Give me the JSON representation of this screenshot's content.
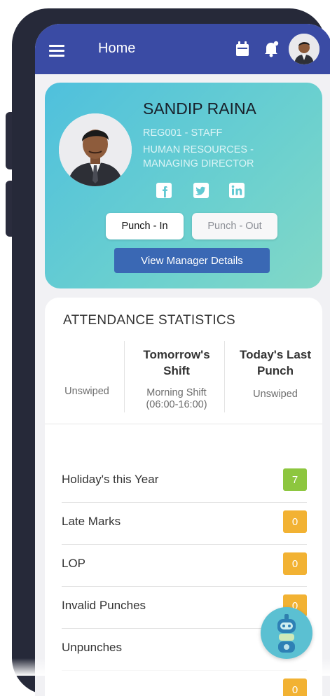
{
  "appbar": {
    "title": "Home",
    "menu_icon": "hamburger-icon",
    "calendar_icon": "calendar-icon",
    "notifications_icon": "bell-icon"
  },
  "profile": {
    "name": "SANDIP RAINA",
    "id_role": "REG001 - STAFF",
    "department_line1": "HUMAN RESOURCES -",
    "department_line2": "MANAGING DIRECTOR",
    "social": [
      "facebook-icon",
      "twitter-icon",
      "linkedin-icon"
    ],
    "punch_in_label": "Punch - In",
    "punch_out_label": "Punch - Out",
    "manager_label": "View Manager Details"
  },
  "attendance": {
    "title": "ATTENDANCE STATISTICS",
    "columns": [
      {
        "header": "",
        "value": "Unswiped"
      },
      {
        "header_line1": "Tomorrow's",
        "header_line2": "Shift",
        "value_line1": "Morning Shift",
        "value_line2": "(06:00-16:00)"
      },
      {
        "header_line1": "Today's Last",
        "header_line2": "Punch",
        "value": "Unswiped"
      }
    ],
    "rows": [
      {
        "label": "Holiday's this Year",
        "count": "7",
        "color": "#8dc63f"
      },
      {
        "label": "Late Marks",
        "count": "0",
        "color": "#f2b233"
      },
      {
        "label": "LOP",
        "count": "0",
        "color": "#f2b233"
      },
      {
        "label": "Invalid Punches",
        "count": "0",
        "color": "#f2b233"
      },
      {
        "label": "Unpunches",
        "count": "",
        "color": "#f2b233"
      },
      {
        "label": "",
        "count": "0",
        "color": "#f2b233"
      }
    ]
  },
  "colors": {
    "appbar": "#3a4ba4",
    "card_gradient_start": "#4fc0dd",
    "card_gradient_end": "#82d8c7",
    "manager_button": "#3a68b4",
    "badge_green": "#8dc63f",
    "badge_orange": "#f2b233"
  }
}
